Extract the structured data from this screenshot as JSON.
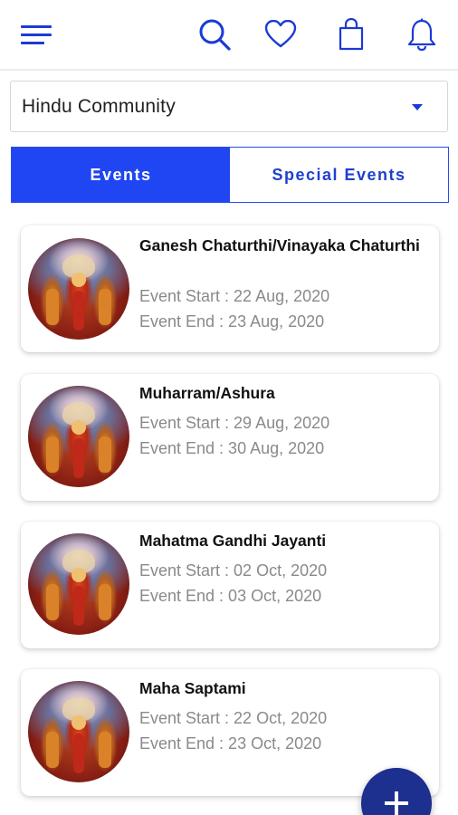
{
  "header": {
    "icons": [
      "menu-icon",
      "search-icon",
      "heart-icon",
      "shopping-bag-icon",
      "bell-icon"
    ],
    "accent_color": "#1a3bd6"
  },
  "community_select": {
    "value": "Hindu Community"
  },
  "tabs": [
    {
      "label": "Events",
      "active": true
    },
    {
      "label": "Special Events",
      "active": false
    }
  ],
  "events": [
    {
      "title": "Ganesh Chaturthi/Vinayaka Chaturthi",
      "start": "Event Start : 22 Aug, 2020",
      "end": "Event End : 23 Aug, 2020"
    },
    {
      "title": "Muharram/Ashura",
      "start": "Event Start : 29 Aug, 2020",
      "end": "Event End : 30 Aug, 2020"
    },
    {
      "title": "Mahatma Gandhi Jayanti",
      "start": "Event Start : 02 Oct, 2020",
      "end": "Event End : 03 Oct, 2020"
    },
    {
      "title": "Maha Saptami",
      "start": "Event Start : 22 Oct, 2020",
      "end": "Event End : 23 Oct, 2020"
    }
  ],
  "fab": {
    "icon": "plus-icon",
    "color": "#1d2f8f"
  }
}
